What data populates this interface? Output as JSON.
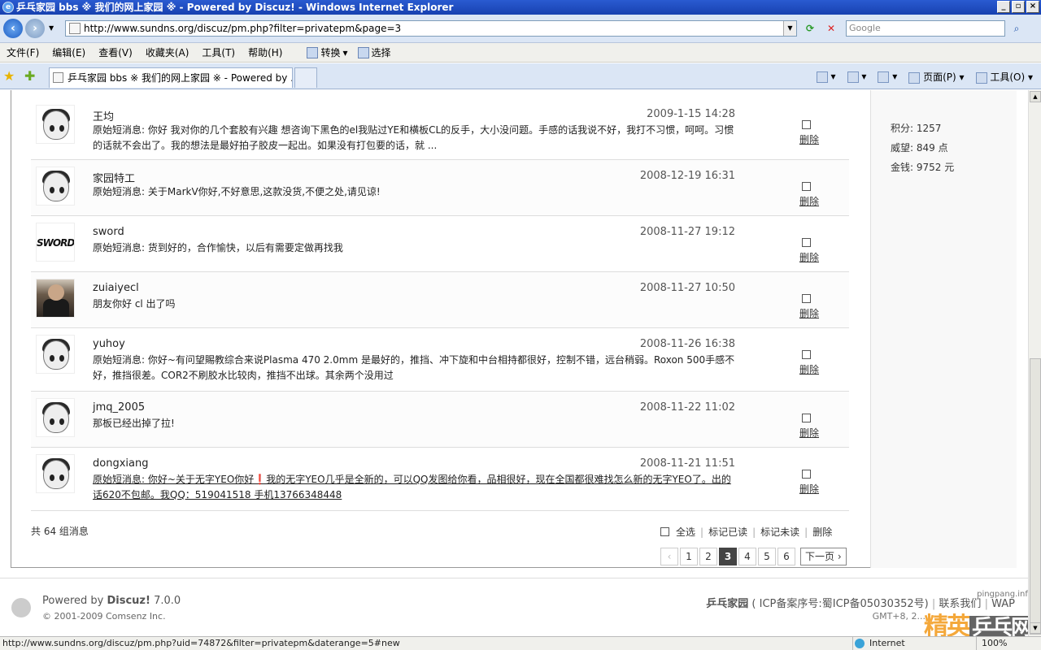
{
  "window": {
    "title": "乒乓家园 bbs ※ 我们的网上家园 ※ - Powered by Discuz! - Windows Internet Explorer",
    "buttons": [
      "_",
      "▫",
      "×"
    ]
  },
  "address": {
    "url": "http://www.sundns.org/discuz/pm.php?filter=privatepm&page=3",
    "search_placeholder": "Google"
  },
  "menu": [
    "文件(F)",
    "编辑(E)",
    "查看(V)",
    "收藏夹(A)",
    "工具(T)",
    "帮助(H)"
  ],
  "menu_tools": {
    "convert": "转换",
    "select": "选择"
  },
  "tab": {
    "label": "乒乓家园 bbs ※ 我们的网上家园 ※ - Powered by ..."
  },
  "commands": {
    "page": "页面(P)",
    "tools": "工具(O)"
  },
  "sidebar": {
    "score": "积分: 1257",
    "prestige": "威望: 849 点",
    "money": "金钱: 9752 元"
  },
  "messages": [
    {
      "user": "王均",
      "date": "2009-1-15 14:28",
      "text": "原始短消息: 你好 我对你的几个套胶有兴趣 想咨询下黑色的el我贴过YE和横板CL的反手，大小没问题。手感的话我说不好，我打不习惯，呵呵。习惯的话就不会出了。我的想法是最好拍子胶皮一起出。如果没有打包要的话，就 ...",
      "avatar": "boy",
      "delete": "删除"
    },
    {
      "user": "家园特工",
      "date": "2008-12-19 16:31",
      "text": "原始短消息: 关于MarkV你好,不好意思,这款没货,不便之处,请见谅!",
      "avatar": "boy",
      "delete": "删除"
    },
    {
      "user": "sword",
      "date": "2008-11-27 19:12",
      "text": "原始短消息: 货到好的，合作愉快，以后有需要定做再找我",
      "avatar": "sword",
      "avatar_text": "SWORD",
      "delete": "删除"
    },
    {
      "user": "zuiaiyecl",
      "date": "2008-11-27 10:50",
      "text": "朋友你好 cl 出了吗",
      "avatar": "photo",
      "delete": "删除"
    },
    {
      "user": "yuhoy",
      "date": "2008-11-26 16:38",
      "text": "原始短消息: 你好~有问望賜教综合来说Plasma 470 2.0mm 是最好的，推挡、冲下旋和中台相持都很好，控制不错，远台稍弱。Roxon 500手感不好，推挡很差。COR2不刷胶水比较肉，推挡不出球。其余两个没用过",
      "avatar": "boy",
      "delete": "删除"
    },
    {
      "user": "jmq_2005",
      "date": "2008-11-22 11:02",
      "text": "那板已经出掉了拉!",
      "avatar": "boy",
      "delete": "删除"
    },
    {
      "user": "dongxiang",
      "date": "2008-11-21 11:51",
      "text": "原始短消息: 你好~关于无字YEO你好❗我的无字YEO几乎是全新的，可以QQ发图给你看，品相很好，现在全国都很难找怎么新的无字YEO了。出的话620不包邮。我QQ：519041518 手机13766348448",
      "avatar": "boy",
      "delete": "删除",
      "underline": true
    }
  ],
  "summary": "共 64 组消息",
  "actions": {
    "select_all": "全选",
    "mark_read": "标记已读",
    "mark_unread": "标记未读",
    "delete": "删除"
  },
  "pager": {
    "prev": "‹",
    "pages": [
      "1",
      "2",
      "3",
      "4",
      "5",
      "6"
    ],
    "current": "3",
    "next": "下一页 ›"
  },
  "footer": {
    "powered_prefix": "Powered by ",
    "powered_name": "Discuz!",
    "powered_version": " 7.0.0",
    "copyright": "© 2001-2009 Comsenz Inc.",
    "site": "乒乓家园",
    "icp": "( ICP备案序号:蜀ICP备05030352号)",
    "contact": "联系我们",
    "wap": "WAP",
    "gmt": "GMT+8, 2...",
    "watermark_small": "pingpang.info",
    "watermark_a": "精英",
    "watermark_b": "乒乓网"
  },
  "status": {
    "url": "http://www.sundns.org/discuz/pm.php?uid=74872&filter=privatepm&daterange=5#new",
    "zone": "Internet",
    "zoom": "100%"
  }
}
